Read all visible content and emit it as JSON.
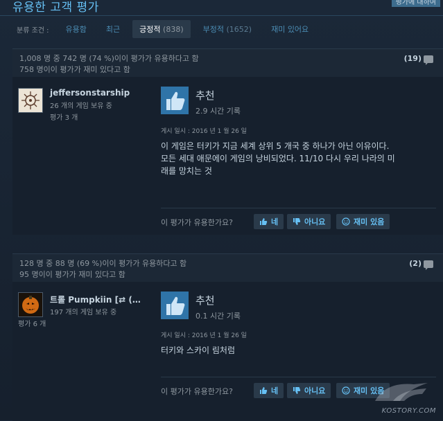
{
  "header": {
    "title": "유용한 고객 평가",
    "right_tab": "평가에 대하여"
  },
  "filters": {
    "label": "분류 조건 :",
    "tabs": [
      {
        "label": "유용함",
        "count": ""
      },
      {
        "label": "최근",
        "count": ""
      },
      {
        "label": "긍정적",
        "count": "(838)"
      },
      {
        "label": "부정적",
        "count": "(1652)"
      },
      {
        "label": "재미 있어요",
        "count": ""
      }
    ],
    "active": "긍정적"
  },
  "reviews": [
    {
      "helpful_line": "1,008 명 중 742 명 (74 %)이이 평가가 유용하다고 함",
      "funny_line": "758 명이이 평가가 재미 있다고 함",
      "comments": "(19)",
      "user": {
        "name": "jeffersonstarship",
        "games": "26 개의 게임 보유 중",
        "reviews": "평가 3 개"
      },
      "recommendation": "추천",
      "hours": "2.9 시간 기록",
      "posted": "게시 일시 : 2016 년 1 월 26 일",
      "text_lines": [
        "이 게임은 터키가 지금 세계 상위 5 개국 중 하나가 아닌 이유이다.",
        "모든 세대 애문에이 게임의 낭비되었다. 11/10 다시 우리 나라의 미",
        "래를 망치는 것"
      ],
      "helpful_question": "이 평가가 유용한가요?",
      "buttons": {
        "yes": "네",
        "no": "아니요",
        "funny": "재미 있음"
      }
    },
    {
      "helpful_line": "128 명 중 88 명 (69 %)이이 평가가 유용하다고 함",
      "funny_line": "95 명이이 평가가 재미 있다고 함",
      "comments": "(2)",
      "user": {
        "name": "트롤 Pumpkiin [⇄ (…",
        "games": "197 개의 게임 보유 중",
        "reviews": "평가 6 개"
      },
      "recommendation": "추천",
      "hours": "0.1 시간 기록",
      "posted": "게시 일시 : 2016 년 1 월 26 일",
      "text_lines": [
        "터키와 스카이 림처럼"
      ],
      "helpful_question": "이 평가가 유용한가요?",
      "buttons": {
        "yes": "네",
        "no": "아니요",
        "funny": "재미 있음"
      }
    }
  ],
  "watermark": "KOSTORY.COM",
  "colors": {
    "page_bg": "#1b2838",
    "accent_blue": "#66c0f4",
    "thumb_bg": "#2a6a9c",
    "button_bg": "#2a3a4a"
  },
  "icons": [
    "thumbs-up-icon",
    "thumbs-down-icon",
    "smile-icon",
    "comment-icon"
  ]
}
